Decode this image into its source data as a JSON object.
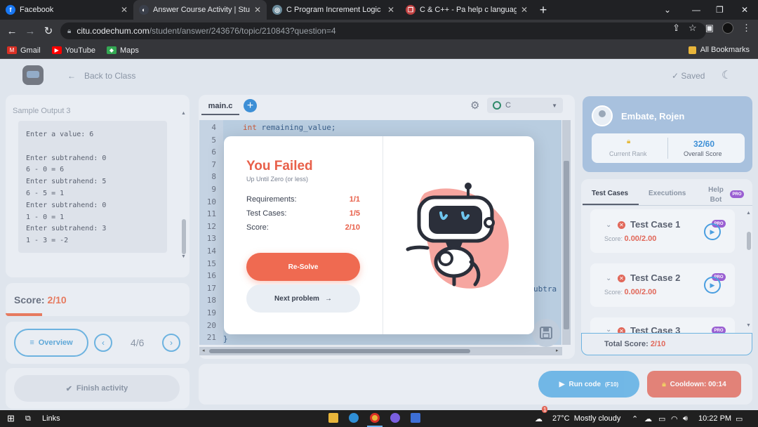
{
  "browser": {
    "tabs": [
      {
        "label": "Facebook",
        "fav": "f",
        "color": "#1877f2"
      },
      {
        "label": "Answer Course Activity | Student",
        "fav": "◐",
        "color": "#3a3f4a"
      },
      {
        "label": "C Program Increment Logic",
        "fav": "◎",
        "color": "#6a8a9a"
      },
      {
        "label": "C & C++ - Pa help c language | ",
        "fav": "❒",
        "color": "#c04040"
      }
    ],
    "url_host": "citu.codechum.com",
    "url_path": "/student/answer/243676/topic/210843?question=4",
    "bookmarks": [
      "Gmail",
      "YouTube",
      "Maps"
    ],
    "all_bookmarks": "All Bookmarks"
  },
  "header": {
    "back_label": "Back to Class",
    "saved_label": "Saved"
  },
  "left": {
    "sample_label": "Sample Output 3",
    "sample_output": "Enter a value: 6\n\nEnter subtrahend: 0\n6 - 0 = 6\nEnter subtrahend: 5\n6 - 5 = 1\nEnter subtrahend: 0\n1 - 0 = 1\nEnter subtrahend: 3\n1 - 3 = -2",
    "score_label": "Score: ",
    "score_value": "2/10",
    "overview_label": "Overview",
    "page_indicator": "4/6",
    "finish_label": "Finish activity"
  },
  "editor": {
    "file_name": "main.c",
    "language": "C",
    "line_numbers": [
      "4",
      "5",
      "6",
      "7",
      "8",
      "9",
      "10",
      "11",
      "12",
      "13",
      "14",
      "15",
      "16",
      "17",
      "18",
      "19",
      "20",
      "21"
    ],
    "line4_kw": "int",
    "line4_rest": " remaining_value;",
    "line21": "}",
    "line17_tail": "ubtra"
  },
  "bottom": {
    "run_label": "Run code",
    "run_hint": "(F10)",
    "cooldown_label": "Cooldown: 00:14"
  },
  "right": {
    "user_name": "Embate, Rojen",
    "rank_label": "Current Rank",
    "overall_value": "32/60",
    "overall_label": "Overall Score",
    "tabs": [
      "Test Cases",
      "Executions",
      "Help Bot"
    ],
    "pro": "PRO",
    "test_cases": [
      {
        "title": "Test Case 1",
        "score_label": "Score: ",
        "score": "0.00/2.00"
      },
      {
        "title": "Test Case 2",
        "score_label": "Score: ",
        "score": "0.00/2.00"
      },
      {
        "title": "Test Case 3"
      }
    ],
    "total_label": "Total Score: ",
    "total_value": "2/10"
  },
  "modal": {
    "title": "You Failed",
    "subtitle": "Up Until Zero (or less)",
    "rows": [
      {
        "label": "Requirements:",
        "value": "1/1"
      },
      {
        "label": "Test Cases:",
        "value": "1/5"
      },
      {
        "label": "Score:",
        "value": "2/10"
      }
    ],
    "resolve_label": "Re-Solve",
    "next_label": "Next problem"
  },
  "taskbar": {
    "search_label": "Links",
    "weather": "27°C  Mostly cloudy",
    "time": "10:22 PM",
    "notif_count": "1"
  },
  "colors": {
    "accent_red": "#e8604a",
    "accent_blue": "#3d8fd6"
  }
}
